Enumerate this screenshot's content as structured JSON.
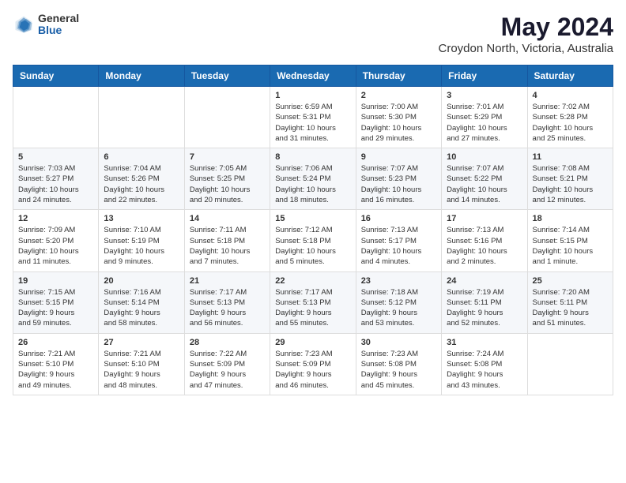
{
  "logo": {
    "general": "General",
    "blue": "Blue"
  },
  "header": {
    "title": "May 2024",
    "subtitle": "Croydon North, Victoria, Australia"
  },
  "weekdays": [
    "Sunday",
    "Monday",
    "Tuesday",
    "Wednesday",
    "Thursday",
    "Friday",
    "Saturday"
  ],
  "weeks": [
    [
      {
        "day": "",
        "info": ""
      },
      {
        "day": "",
        "info": ""
      },
      {
        "day": "",
        "info": ""
      },
      {
        "day": "1",
        "info": "Sunrise: 6:59 AM\nSunset: 5:31 PM\nDaylight: 10 hours\nand 31 minutes."
      },
      {
        "day": "2",
        "info": "Sunrise: 7:00 AM\nSunset: 5:30 PM\nDaylight: 10 hours\nand 29 minutes."
      },
      {
        "day": "3",
        "info": "Sunrise: 7:01 AM\nSunset: 5:29 PM\nDaylight: 10 hours\nand 27 minutes."
      },
      {
        "day": "4",
        "info": "Sunrise: 7:02 AM\nSunset: 5:28 PM\nDaylight: 10 hours\nand 25 minutes."
      }
    ],
    [
      {
        "day": "5",
        "info": "Sunrise: 7:03 AM\nSunset: 5:27 PM\nDaylight: 10 hours\nand 24 minutes."
      },
      {
        "day": "6",
        "info": "Sunrise: 7:04 AM\nSunset: 5:26 PM\nDaylight: 10 hours\nand 22 minutes."
      },
      {
        "day": "7",
        "info": "Sunrise: 7:05 AM\nSunset: 5:25 PM\nDaylight: 10 hours\nand 20 minutes."
      },
      {
        "day": "8",
        "info": "Sunrise: 7:06 AM\nSunset: 5:24 PM\nDaylight: 10 hours\nand 18 minutes."
      },
      {
        "day": "9",
        "info": "Sunrise: 7:07 AM\nSunset: 5:23 PM\nDaylight: 10 hours\nand 16 minutes."
      },
      {
        "day": "10",
        "info": "Sunrise: 7:07 AM\nSunset: 5:22 PM\nDaylight: 10 hours\nand 14 minutes."
      },
      {
        "day": "11",
        "info": "Sunrise: 7:08 AM\nSunset: 5:21 PM\nDaylight: 10 hours\nand 12 minutes."
      }
    ],
    [
      {
        "day": "12",
        "info": "Sunrise: 7:09 AM\nSunset: 5:20 PM\nDaylight: 10 hours\nand 11 minutes."
      },
      {
        "day": "13",
        "info": "Sunrise: 7:10 AM\nSunset: 5:19 PM\nDaylight: 10 hours\nand 9 minutes."
      },
      {
        "day": "14",
        "info": "Sunrise: 7:11 AM\nSunset: 5:18 PM\nDaylight: 10 hours\nand 7 minutes."
      },
      {
        "day": "15",
        "info": "Sunrise: 7:12 AM\nSunset: 5:18 PM\nDaylight: 10 hours\nand 5 minutes."
      },
      {
        "day": "16",
        "info": "Sunrise: 7:13 AM\nSunset: 5:17 PM\nDaylight: 10 hours\nand 4 minutes."
      },
      {
        "day": "17",
        "info": "Sunrise: 7:13 AM\nSunset: 5:16 PM\nDaylight: 10 hours\nand 2 minutes."
      },
      {
        "day": "18",
        "info": "Sunrise: 7:14 AM\nSunset: 5:15 PM\nDaylight: 10 hours\nand 1 minute."
      }
    ],
    [
      {
        "day": "19",
        "info": "Sunrise: 7:15 AM\nSunset: 5:15 PM\nDaylight: 9 hours\nand 59 minutes."
      },
      {
        "day": "20",
        "info": "Sunrise: 7:16 AM\nSunset: 5:14 PM\nDaylight: 9 hours\nand 58 minutes."
      },
      {
        "day": "21",
        "info": "Sunrise: 7:17 AM\nSunset: 5:13 PM\nDaylight: 9 hours\nand 56 minutes."
      },
      {
        "day": "22",
        "info": "Sunrise: 7:17 AM\nSunset: 5:13 PM\nDaylight: 9 hours\nand 55 minutes."
      },
      {
        "day": "23",
        "info": "Sunrise: 7:18 AM\nSunset: 5:12 PM\nDaylight: 9 hours\nand 53 minutes."
      },
      {
        "day": "24",
        "info": "Sunrise: 7:19 AM\nSunset: 5:11 PM\nDaylight: 9 hours\nand 52 minutes."
      },
      {
        "day": "25",
        "info": "Sunrise: 7:20 AM\nSunset: 5:11 PM\nDaylight: 9 hours\nand 51 minutes."
      }
    ],
    [
      {
        "day": "26",
        "info": "Sunrise: 7:21 AM\nSunset: 5:10 PM\nDaylight: 9 hours\nand 49 minutes."
      },
      {
        "day": "27",
        "info": "Sunrise: 7:21 AM\nSunset: 5:10 PM\nDaylight: 9 hours\nand 48 minutes."
      },
      {
        "day": "28",
        "info": "Sunrise: 7:22 AM\nSunset: 5:09 PM\nDaylight: 9 hours\nand 47 minutes."
      },
      {
        "day": "29",
        "info": "Sunrise: 7:23 AM\nSunset: 5:09 PM\nDaylight: 9 hours\nand 46 minutes."
      },
      {
        "day": "30",
        "info": "Sunrise: 7:23 AM\nSunset: 5:08 PM\nDaylight: 9 hours\nand 45 minutes."
      },
      {
        "day": "31",
        "info": "Sunrise: 7:24 AM\nSunset: 5:08 PM\nDaylight: 9 hours\nand 43 minutes."
      },
      {
        "day": "",
        "info": ""
      }
    ]
  ]
}
